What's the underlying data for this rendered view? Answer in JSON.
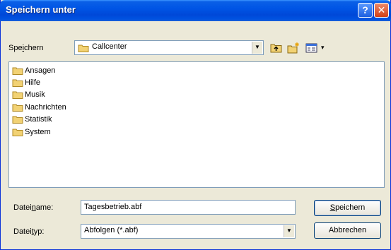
{
  "window": {
    "title": "Speichern unter",
    "help_glyph": "?",
    "close_glyph": "✕"
  },
  "location": {
    "label_pre": "Spe",
    "label_key": "i",
    "label_post": "chern",
    "value": "Callcenter"
  },
  "toolbar": {
    "view_menu_glyph": "▾"
  },
  "folders": [
    {
      "name": "Ansagen"
    },
    {
      "name": "Hilfe"
    },
    {
      "name": "Musik"
    },
    {
      "name": "Nachrichten"
    },
    {
      "name": "Statistik"
    },
    {
      "name": "System"
    }
  ],
  "filename": {
    "label_pre": "Datei",
    "label_key": "n",
    "label_post": "ame:",
    "value": "Tagesbetrieb.abf"
  },
  "filetype": {
    "label_pre": "Datei",
    "label_key": "t",
    "label_post": "yp:",
    "value": "Abfolgen (*.abf)"
  },
  "buttons": {
    "save_key": "S",
    "save_rest": "peichern",
    "cancel": "Abbrechen"
  },
  "colors": {
    "title_bar": "#0055e5",
    "folder": "#f2d274",
    "border": "#7f9db9"
  }
}
